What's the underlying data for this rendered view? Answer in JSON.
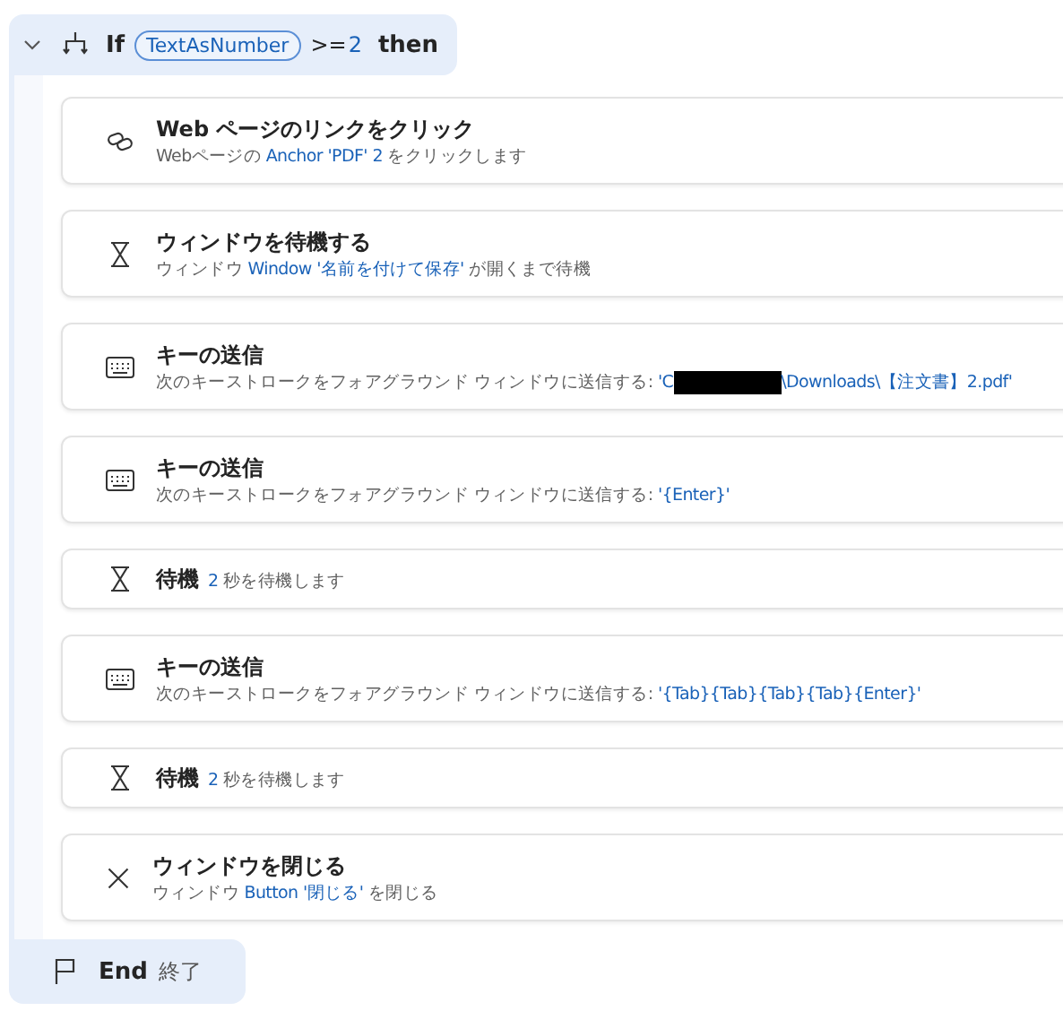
{
  "header": {
    "expanded": true,
    "keyword": "If",
    "variable": "TextAsNumber",
    "operator": ">=",
    "value": "2",
    "then": "then"
  },
  "steps": [
    {
      "kind": "click-link",
      "title": "Web ページのリンクをクリック",
      "parts": [
        {
          "kind": "text",
          "text": "Webページの "
        },
        {
          "kind": "param",
          "text": "Anchor 'PDF' 2"
        },
        {
          "kind": "text",
          "text": " をクリックします"
        }
      ]
    },
    {
      "kind": "wait-window",
      "title": "ウィンドウを待機する",
      "parts": [
        {
          "kind": "text",
          "text": "ウィンドウ "
        },
        {
          "kind": "param",
          "text": "Window '名前を付けて保存'"
        },
        {
          "kind": "text",
          "text": " が開くまで待機"
        }
      ]
    },
    {
      "kind": "send-keys",
      "title": "キーの送信",
      "parts": [
        {
          "kind": "text",
          "text": "次のキーストロークをフォアグラウンド ウィンドウに送信する: "
        },
        {
          "kind": "param",
          "text": "'C"
        },
        {
          "kind": "redacted"
        },
        {
          "kind": "param",
          "text": "\\Downloads\\【注文書】2.pdf'"
        }
      ]
    },
    {
      "kind": "send-keys",
      "title": "キーの送信",
      "parts": [
        {
          "kind": "text",
          "text": "次のキーストロークをフォアグラウンド ウィンドウに送信する: "
        },
        {
          "kind": "param",
          "text": "'{Enter}'"
        }
      ]
    },
    {
      "kind": "wait",
      "title": "待機",
      "parts": [
        {
          "kind": "param",
          "text": "2"
        },
        {
          "kind": "text",
          "text": " 秒を待機します"
        }
      ]
    },
    {
      "kind": "send-keys",
      "title": "キーの送信",
      "parts": [
        {
          "kind": "text",
          "text": "次のキーストロークをフォアグラウンド ウィンドウに送信する: "
        },
        {
          "kind": "param",
          "text": "'{Tab}{Tab}{Tab}{Tab}{Enter}'"
        }
      ]
    },
    {
      "kind": "wait",
      "title": "待機",
      "parts": [
        {
          "kind": "param",
          "text": "2"
        },
        {
          "kind": "text",
          "text": " 秒を待機します"
        }
      ]
    },
    {
      "kind": "close-window",
      "title": "ウィンドウを閉じる",
      "parts": [
        {
          "kind": "text",
          "text": "ウィンドウ "
        },
        {
          "kind": "param",
          "text": "Button '閉じる'"
        },
        {
          "kind": "text",
          "text": " を閉じる"
        }
      ]
    }
  ],
  "end": {
    "keyword": "End",
    "label": "終了"
  }
}
